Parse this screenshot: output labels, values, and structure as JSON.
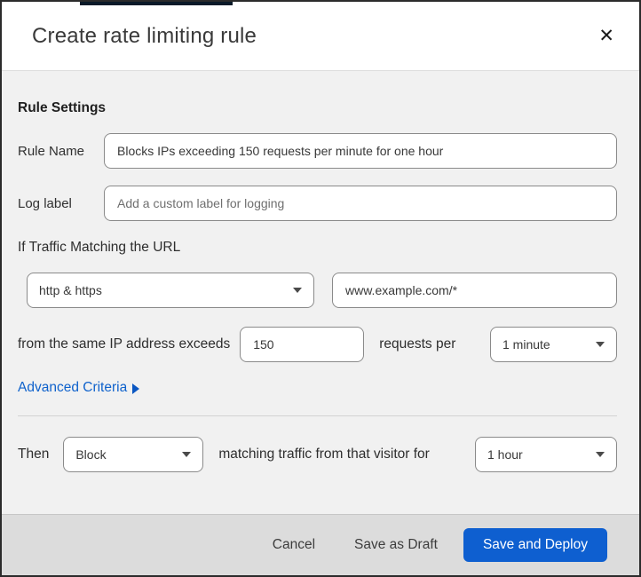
{
  "window": {
    "title": "Create rate limiting rule",
    "close_icon": "✕"
  },
  "colors": {
    "primary_button_blue": "#0e5fd0",
    "link_blue": "#0f62cc",
    "body_bg": "#f1f1f1",
    "footer_bg": "#dcdcdc",
    "top_accent": "#0a1a29"
  },
  "rule_settings": {
    "heading": "Rule Settings",
    "rule_name": {
      "label": "Rule Name",
      "value": "Blocks IPs exceeding 150 requests per minute for one hour"
    },
    "log_label": {
      "label": "Log label",
      "placeholder": "Add a custom label for logging"
    }
  },
  "match": {
    "intro": "If Traffic Matching the URL",
    "scheme_select": {
      "value": "http & https"
    },
    "url_input": {
      "value": "www.example.com/*"
    },
    "threshold": {
      "text_before": "from the same IP address exceeds",
      "value": "150",
      "text_after": "requests per",
      "period_select": {
        "value": "1 minute"
      }
    },
    "advanced_link": "Advanced Criteria"
  },
  "action": {
    "then_label": "Then",
    "action_select": {
      "value": "Block"
    },
    "middle_text": "matching traffic from that visitor for",
    "duration_select": {
      "value": "1 hour"
    }
  },
  "footer": {
    "cancel_label": "Cancel",
    "save_draft_label": "Save as Draft",
    "save_deploy_label": "Save and Deploy"
  }
}
